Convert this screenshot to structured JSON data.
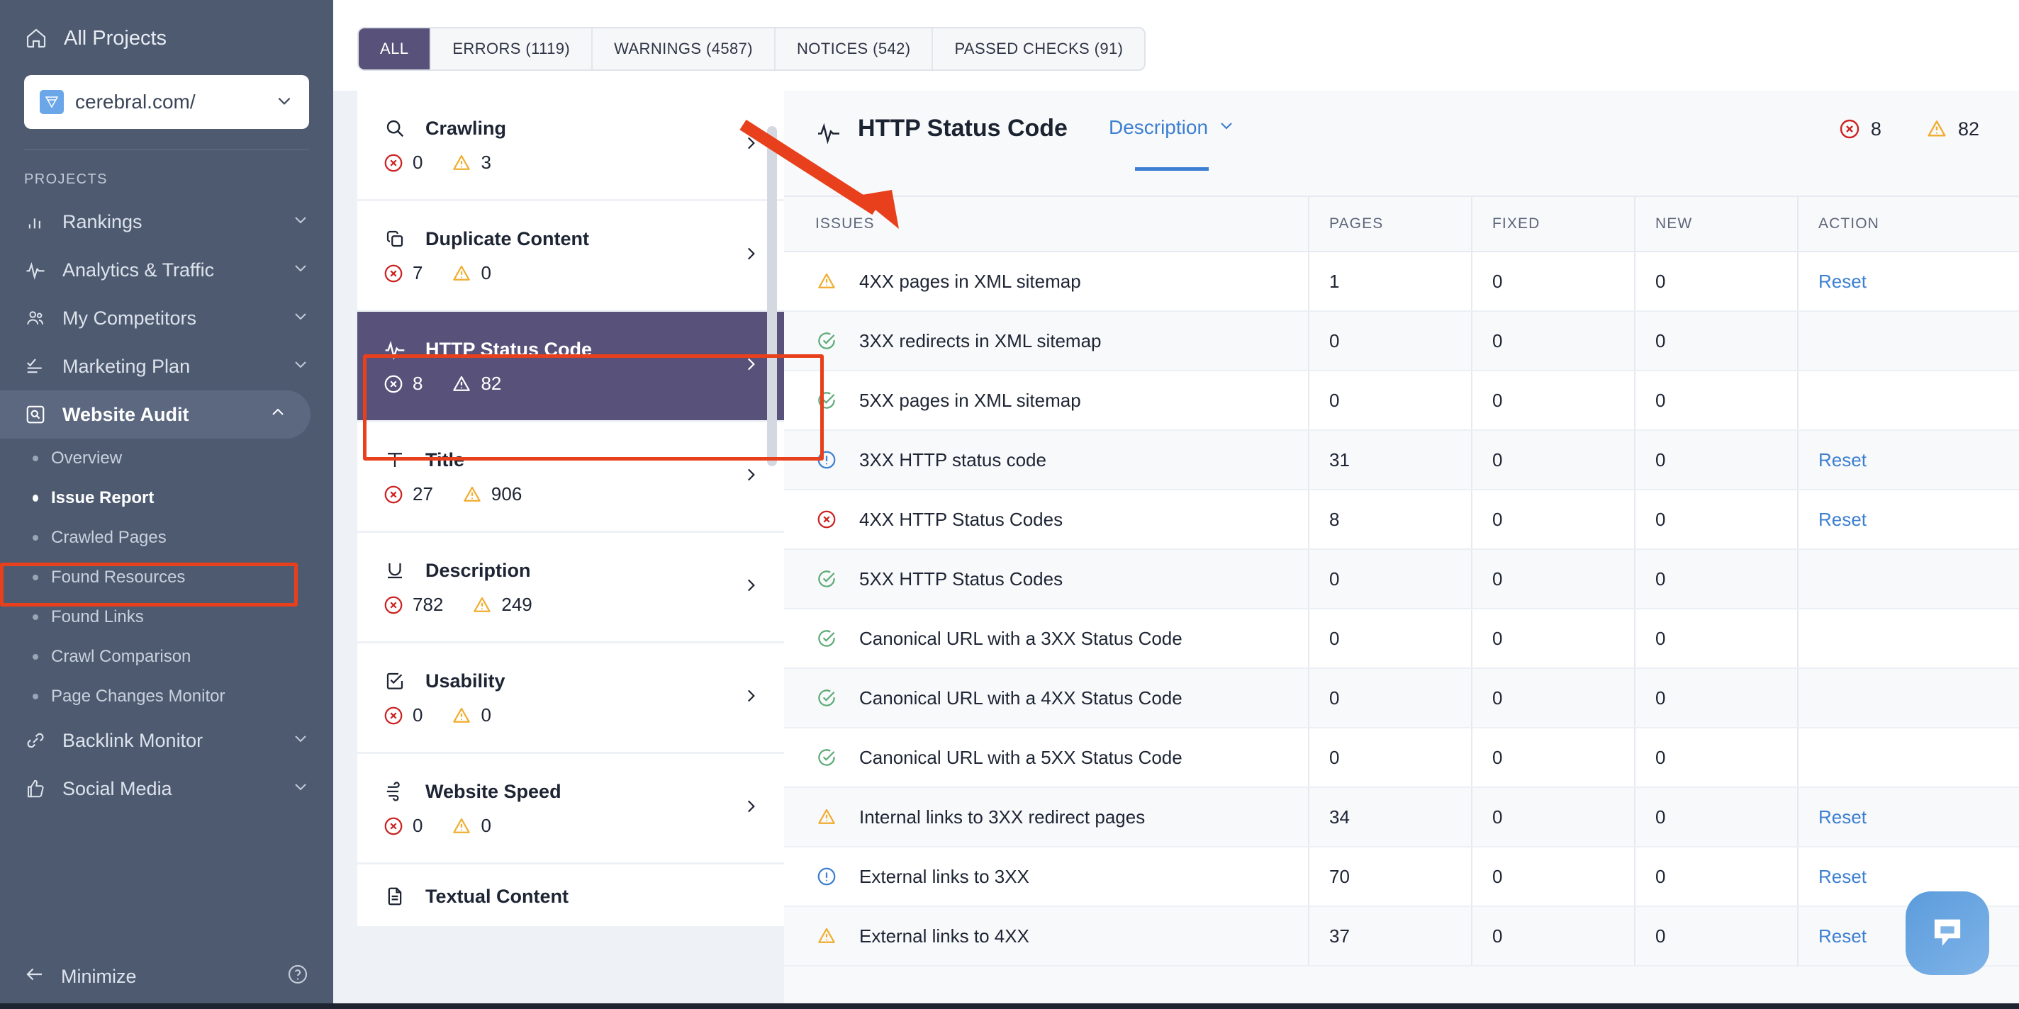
{
  "sidebar": {
    "all_projects_label": "All Projects",
    "project": {
      "name": "cerebral.com/",
      "icon": "site-favicon"
    },
    "section_label": "PROJECTS",
    "nav": [
      {
        "label": "Rankings",
        "icon": "bar-chart-icon",
        "expandable": true,
        "active": false
      },
      {
        "label": "Analytics & Traffic",
        "icon": "pulse-icon",
        "expandable": true,
        "active": false
      },
      {
        "label": "My Competitors",
        "icon": "users-icon",
        "expandable": true,
        "active": false
      },
      {
        "label": "Marketing Plan",
        "icon": "checklist-icon",
        "expandable": true,
        "active": false
      },
      {
        "label": "Website Audit",
        "icon": "audit-search-icon",
        "expandable": true,
        "active": true
      }
    ],
    "sub_nav": [
      {
        "label": "Overview",
        "current": false
      },
      {
        "label": "Issue Report",
        "current": true
      },
      {
        "label": "Crawled Pages",
        "current": false
      },
      {
        "label": "Found Resources",
        "current": false
      },
      {
        "label": "Found Links",
        "current": false
      },
      {
        "label": "Crawl Comparison",
        "current": false
      },
      {
        "label": "Page Changes Monitor",
        "current": false
      }
    ],
    "nav_after": [
      {
        "label": "Backlink Monitor",
        "icon": "link-icon",
        "expandable": true
      },
      {
        "label": "Social Media",
        "icon": "thumbs-up-icon",
        "expandable": true
      }
    ],
    "minimize_label": "Minimize",
    "help_icon": "help-circle-icon"
  },
  "filter_tabs": [
    {
      "label": "ALL",
      "active": true
    },
    {
      "label": "ERRORS (1119)",
      "active": false
    },
    {
      "label": "WARNINGS (4587)",
      "active": false
    },
    {
      "label": "NOTICES (542)",
      "active": false
    },
    {
      "label": "PASSED CHECKS (91)",
      "active": false
    }
  ],
  "categories": [
    {
      "name": "Crawling",
      "icon": "search-icon",
      "errors": "0",
      "warnings": "3",
      "selected": false
    },
    {
      "name": "Duplicate Content",
      "icon": "copy-icon",
      "errors": "7",
      "warnings": "0",
      "selected": false
    },
    {
      "name": "HTTP Status Code",
      "icon": "pulse-icon",
      "errors": "8",
      "warnings": "82",
      "selected": true
    },
    {
      "name": "Title",
      "icon": "text-t-icon",
      "errors": "27",
      "warnings": "906",
      "selected": false
    },
    {
      "name": "Description",
      "icon": "underline-u-icon",
      "errors": "782",
      "warnings": "249",
      "selected": false
    },
    {
      "name": "Usability",
      "icon": "check-square-icon",
      "errors": "0",
      "warnings": "0",
      "selected": false
    },
    {
      "name": "Website Speed",
      "icon": "wind-icon",
      "errors": "0",
      "warnings": "0",
      "selected": false
    },
    {
      "name": "Textual Content",
      "icon": "document-icon",
      "errors": "",
      "warnings": "",
      "selected": false
    }
  ],
  "detail": {
    "icon": "pulse-icon",
    "title": "HTTP Status Code",
    "tab_label": "Description",
    "tab_chevron": "chevron-down-icon",
    "error_count": "8",
    "warning_count": "82",
    "columns": [
      "ISSUES",
      "PAGES",
      "FIXED",
      "NEW",
      "ACTION"
    ],
    "rows": [
      {
        "status": "warning",
        "issue": "4XX pages in XML sitemap",
        "pages": "1",
        "fixed": "0",
        "new": "0",
        "action": "Reset"
      },
      {
        "status": "passed",
        "issue": "3XX redirects in XML sitemap",
        "pages": "0",
        "fixed": "0",
        "new": "0",
        "action": ""
      },
      {
        "status": "passed",
        "issue": "5XX pages in XML sitemap",
        "pages": "0",
        "fixed": "0",
        "new": "0",
        "action": ""
      },
      {
        "status": "notice",
        "issue": "3XX HTTP status code",
        "pages": "31",
        "fixed": "0",
        "new": "0",
        "action": "Reset"
      },
      {
        "status": "error",
        "issue": "4XX HTTP Status Codes",
        "pages": "8",
        "fixed": "0",
        "new": "0",
        "action": "Reset"
      },
      {
        "status": "passed",
        "issue": "5XX HTTP Status Codes",
        "pages": "0",
        "fixed": "0",
        "new": "0",
        "action": ""
      },
      {
        "status": "passed",
        "issue": "Canonical URL with a 3XX Status Code",
        "pages": "0",
        "fixed": "0",
        "new": "0",
        "action": ""
      },
      {
        "status": "passed",
        "issue": "Canonical URL with a 4XX Status Code",
        "pages": "0",
        "fixed": "0",
        "new": "0",
        "action": ""
      },
      {
        "status": "passed",
        "issue": "Canonical URL with a 5XX Status Code",
        "pages": "0",
        "fixed": "0",
        "new": "0",
        "action": ""
      },
      {
        "status": "warning",
        "issue": "Internal links to 3XX redirect pages",
        "pages": "34",
        "fixed": "0",
        "new": "0",
        "action": "Reset"
      },
      {
        "status": "notice",
        "issue": "External links to 3XX",
        "pages": "70",
        "fixed": "0",
        "new": "0",
        "action": "Reset"
      },
      {
        "status": "warning",
        "issue": "External links to 4XX",
        "pages": "37",
        "fixed": "0",
        "new": "0",
        "action": "Reset"
      }
    ]
  },
  "chat_widget": {
    "icon": "chat-bubble-icon"
  },
  "annotations": {
    "arrow_color": "#e8401c",
    "highlight_color": "#e8401c"
  },
  "colors": {
    "sidebar_bg": "#4d5a70",
    "selected_purple": "#58527a",
    "link_blue": "#3d7fd1",
    "error_red": "#cc2222",
    "warning_amber": "#f0ad2e",
    "passed_green": "#5eab79",
    "notice_blue": "#3d7fd1"
  }
}
